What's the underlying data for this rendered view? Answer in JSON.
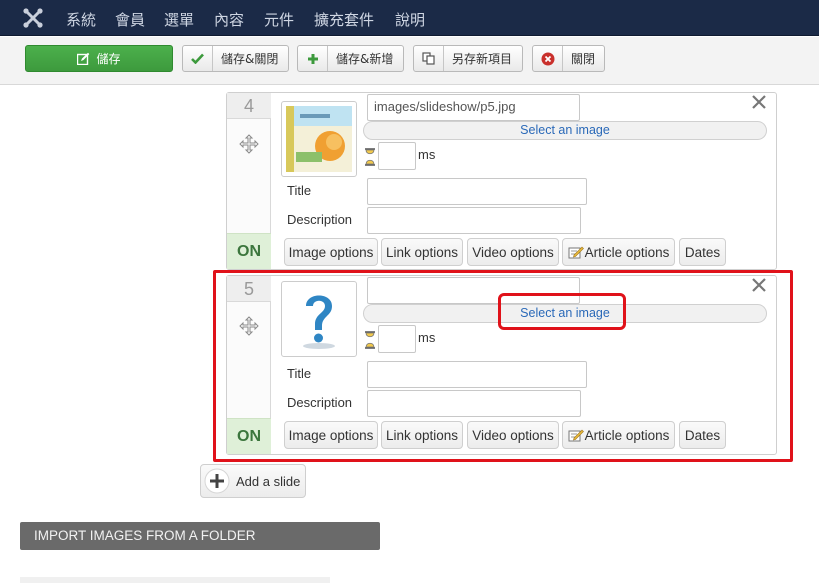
{
  "nav": {
    "items": [
      "系統",
      "會員",
      "選單",
      "內容",
      "元件",
      "擴充套件",
      "說明"
    ]
  },
  "toolbar": {
    "save": "儲存",
    "save_close": "儲存&關閉",
    "save_new": "儲存&新增",
    "save_copy": "另存新項目",
    "close": "關閉"
  },
  "slides": [
    {
      "number": "4",
      "image_path": "images/slideshow/p5.jpg",
      "select_image": "Select an image",
      "ms_label": "ms",
      "title_label": "Title",
      "description_label": "Description",
      "status": "ON",
      "options": [
        "Image options",
        "Link options",
        "Video options",
        "Article options",
        "Dates"
      ]
    },
    {
      "number": "5",
      "image_path": "",
      "select_image": "Select an image",
      "ms_label": "ms",
      "title_label": "Title",
      "description_label": "Description",
      "status": "ON",
      "options": [
        "Image options",
        "Link options",
        "Video options",
        "Article options",
        "Dates"
      ]
    }
  ],
  "add_slide": "Add a slide",
  "import_section": "IMPORT IMAGES FROM A FOLDER",
  "colors": {
    "nav_bg": "#1b2a47",
    "save_green": "#3d9a3d",
    "highlight_red": "#e0121a",
    "link_blue": "#2a69b8",
    "on_green": "#3c763d"
  }
}
